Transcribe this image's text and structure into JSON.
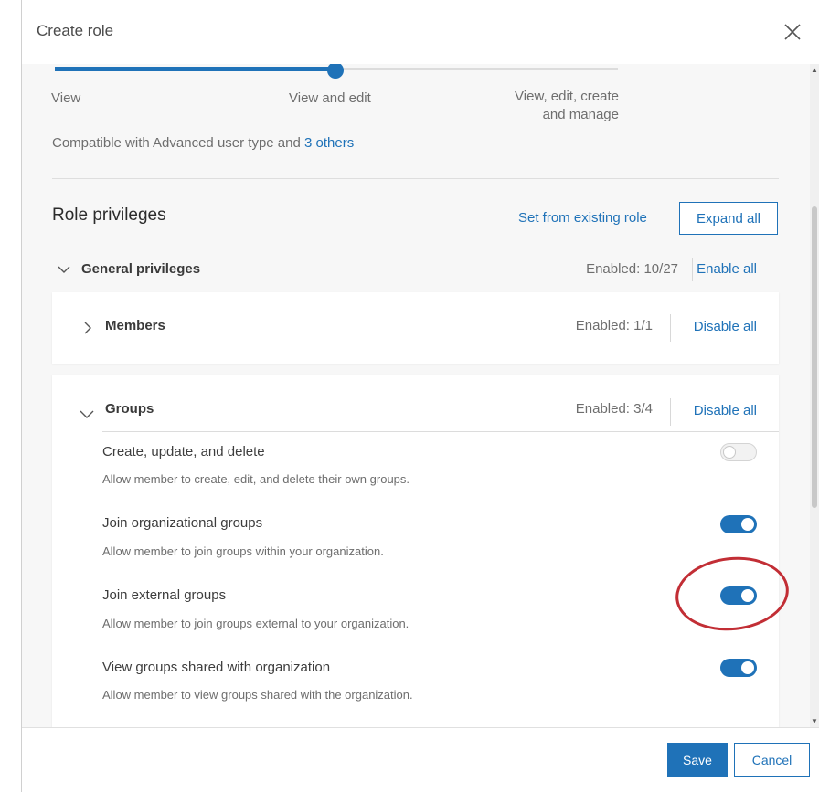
{
  "dialog": {
    "title": "Create role",
    "close_icon": "close-icon"
  },
  "access_levels": {
    "options": [
      "View",
      "View and edit",
      "View, edit, create and manage"
    ],
    "selected": "View and edit",
    "manage_line1": "View, edit, create",
    "manage_line2": "and manage"
  },
  "compatibility": {
    "text": "Compatible with Advanced user type and ",
    "link": "3 others"
  },
  "privileges": {
    "title": "Role privileges",
    "set_from_existing": "Set from existing role",
    "expand_all": "Expand all",
    "general": {
      "label": "General privileges",
      "count": "Enabled: 10/27",
      "action": "Enable all",
      "expand_icon": "chevron-down-icon"
    },
    "members": {
      "label": "Members",
      "count": "Enabled: 1/1",
      "action": "Disable all",
      "expand_icon": "chevron-right-icon"
    },
    "groups": {
      "label": "Groups",
      "count": "Enabled: 3/4",
      "action": "Disable all",
      "expand_icon": "chevron-down-icon",
      "items": [
        {
          "title": "Create, update, and delete",
          "description": "Allow member to create, edit, and delete their own groups.",
          "enabled": false
        },
        {
          "title": "Join organizational groups",
          "description": "Allow member to join groups within your organization.",
          "enabled": true
        },
        {
          "title": "Join external groups",
          "description": "Allow member to join groups external to your organization.",
          "enabled": true
        },
        {
          "title": "View groups shared with organization",
          "description": "Allow member to view groups shared with the organization.",
          "enabled": true
        }
      ]
    }
  },
  "annotation": {
    "color": "#c22e35"
  },
  "footer": {
    "save": "Save",
    "cancel": "Cancel"
  },
  "colors": {
    "accent": "#1f72b8",
    "toggle_off": "#f2f2f2"
  }
}
